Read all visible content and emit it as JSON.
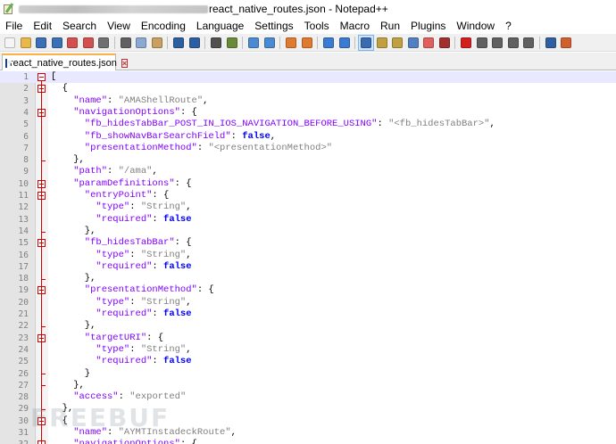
{
  "window": {
    "title": "react_native_routes.json - Notepad++"
  },
  "menu": [
    "File",
    "Edit",
    "Search",
    "View",
    "Encoding",
    "Language",
    "Settings",
    "Tools",
    "Macro",
    "Run",
    "Plugins",
    "Window",
    "?"
  ],
  "toolbar_icons": [
    {
      "name": "new-file-icon",
      "color": "#f5f5f5"
    },
    {
      "name": "open-file-icon",
      "color": "#e8b84a"
    },
    {
      "name": "save-icon",
      "color": "#3b6fb6"
    },
    {
      "name": "save-all-icon",
      "color": "#3b6fb6"
    },
    {
      "name": "close-icon",
      "color": "#d45050"
    },
    {
      "name": "close-all-icon",
      "color": "#d45050"
    },
    {
      "name": "print-icon",
      "color": "#707070"
    },
    {
      "name": "sep"
    },
    {
      "name": "cut-icon",
      "color": "#606060"
    },
    {
      "name": "copy-icon",
      "color": "#8aa8d0"
    },
    {
      "name": "paste-icon",
      "color": "#c8a060"
    },
    {
      "name": "sep"
    },
    {
      "name": "undo-icon",
      "color": "#2d5fa0"
    },
    {
      "name": "redo-icon",
      "color": "#2d5fa0"
    },
    {
      "name": "sep"
    },
    {
      "name": "find-icon",
      "color": "#505050"
    },
    {
      "name": "replace-icon",
      "color": "#6a8a3a"
    },
    {
      "name": "sep"
    },
    {
      "name": "zoom-in-icon",
      "color": "#4a8ad0"
    },
    {
      "name": "zoom-out-icon",
      "color": "#4a8ad0"
    },
    {
      "name": "sep"
    },
    {
      "name": "sync-vertical-icon",
      "color": "#e07a30"
    },
    {
      "name": "sync-horizontal-icon",
      "color": "#e07a30"
    },
    {
      "name": "sep"
    },
    {
      "name": "word-wrap-icon",
      "color": "#3a7ad0"
    },
    {
      "name": "show-all-chars-icon",
      "color": "#3a7ad0"
    },
    {
      "name": "sep"
    },
    {
      "name": "indent-guide-icon",
      "color": "#3a6ab0",
      "active": true
    },
    {
      "name": "language-icon",
      "color": "#c0a040"
    },
    {
      "name": "document-map-icon",
      "color": "#c0a040"
    },
    {
      "name": "function-list-icon",
      "color": "#5080c0"
    },
    {
      "name": "folder-workspace-icon",
      "color": "#e06060"
    },
    {
      "name": "monitoring-icon",
      "color": "#a03030"
    },
    {
      "name": "sep"
    },
    {
      "name": "record-macro-icon",
      "color": "#d02020"
    },
    {
      "name": "stop-record-icon",
      "color": "#606060"
    },
    {
      "name": "playback-macro-icon",
      "color": "#606060"
    },
    {
      "name": "run-macro-multiple-icon",
      "color": "#606060"
    },
    {
      "name": "save-macro-icon",
      "color": "#606060"
    },
    {
      "name": "sep"
    },
    {
      "name": "plugin-manager-icon",
      "color": "#3060a0"
    },
    {
      "name": "plugin-admin-icon",
      "color": "#d06030"
    }
  ],
  "tab": {
    "label": "react_native_routes.json"
  },
  "editor": {
    "lines": [
      {
        "n": "1",
        "tokens": [
          [
            "p",
            "["
          ]
        ],
        "fold": "open",
        "current": true
      },
      {
        "n": "2",
        "tokens": [
          [
            "p",
            "  {"
          ]
        ],
        "fold": "open"
      },
      {
        "n": "3",
        "tokens": [
          [
            "k",
            "    \"name\""
          ],
          [
            "p",
            ": "
          ],
          [
            "s",
            "\"AMAShellRoute\""
          ],
          [
            "p",
            ","
          ]
        ]
      },
      {
        "n": "4",
        "tokens": [
          [
            "k",
            "    \"navigationOptions\""
          ],
          [
            "p",
            ": {"
          ]
        ],
        "fold": "open"
      },
      {
        "n": "5",
        "tokens": [
          [
            "k",
            "      \"fb_hidesTabBar_POST_IN_IOS_NAVIGATION_BEFORE_USING\""
          ],
          [
            "p",
            ": "
          ],
          [
            "s",
            "\"<fb_hidesTabBar>\""
          ],
          [
            "p",
            ","
          ]
        ]
      },
      {
        "n": "6",
        "tokens": [
          [
            "k",
            "      \"fb_showNavBarSearchField\""
          ],
          [
            "p",
            ": "
          ],
          [
            "b",
            "false"
          ],
          [
            "p",
            ","
          ]
        ]
      },
      {
        "n": "7",
        "tokens": [
          [
            "k",
            "      \"presentationMethod\""
          ],
          [
            "p",
            ": "
          ],
          [
            "s",
            "\"<presentationMethod>\""
          ]
        ]
      },
      {
        "n": "8",
        "tokens": [
          [
            "p",
            "    },"
          ]
        ],
        "fold": "end"
      },
      {
        "n": "9",
        "tokens": [
          [
            "k",
            "    \"path\""
          ],
          [
            "p",
            ": "
          ],
          [
            "s",
            "\"/ama\""
          ],
          [
            "p",
            ","
          ]
        ]
      },
      {
        "n": "10",
        "tokens": [
          [
            "k",
            "    \"paramDefinitions\""
          ],
          [
            "p",
            ": {"
          ]
        ],
        "fold": "open"
      },
      {
        "n": "11",
        "tokens": [
          [
            "k",
            "      \"entryPoint\""
          ],
          [
            "p",
            ": {"
          ]
        ],
        "fold": "open"
      },
      {
        "n": "12",
        "tokens": [
          [
            "k",
            "        \"type\""
          ],
          [
            "p",
            ": "
          ],
          [
            "s",
            "\"String\""
          ],
          [
            "p",
            ","
          ]
        ]
      },
      {
        "n": "13",
        "tokens": [
          [
            "k",
            "        \"required\""
          ],
          [
            "p",
            ": "
          ],
          [
            "b",
            "false"
          ]
        ]
      },
      {
        "n": "14",
        "tokens": [
          [
            "p",
            "      },"
          ]
        ],
        "fold": "end"
      },
      {
        "n": "15",
        "tokens": [
          [
            "k",
            "      \"fb_hidesTabBar\""
          ],
          [
            "p",
            ": {"
          ]
        ],
        "fold": "open"
      },
      {
        "n": "16",
        "tokens": [
          [
            "k",
            "        \"type\""
          ],
          [
            "p",
            ": "
          ],
          [
            "s",
            "\"String\""
          ],
          [
            "p",
            ","
          ]
        ]
      },
      {
        "n": "17",
        "tokens": [
          [
            "k",
            "        \"required\""
          ],
          [
            "p",
            ": "
          ],
          [
            "b",
            "false"
          ]
        ]
      },
      {
        "n": "18",
        "tokens": [
          [
            "p",
            "      },"
          ]
        ],
        "fold": "end"
      },
      {
        "n": "19",
        "tokens": [
          [
            "k",
            "      \"presentationMethod\""
          ],
          [
            "p",
            ": {"
          ]
        ],
        "fold": "open"
      },
      {
        "n": "20",
        "tokens": [
          [
            "k",
            "        \"type\""
          ],
          [
            "p",
            ": "
          ],
          [
            "s",
            "\"String\""
          ],
          [
            "p",
            ","
          ]
        ]
      },
      {
        "n": "21",
        "tokens": [
          [
            "k",
            "        \"required\""
          ],
          [
            "p",
            ": "
          ],
          [
            "b",
            "false"
          ]
        ]
      },
      {
        "n": "22",
        "tokens": [
          [
            "p",
            "      },"
          ]
        ],
        "fold": "end"
      },
      {
        "n": "23",
        "tokens": [
          [
            "k",
            "      \"targetURI\""
          ],
          [
            "p",
            ": {"
          ]
        ],
        "fold": "open"
      },
      {
        "n": "24",
        "tokens": [
          [
            "k",
            "        \"type\""
          ],
          [
            "p",
            ": "
          ],
          [
            "s",
            "\"String\""
          ],
          [
            "p",
            ","
          ]
        ]
      },
      {
        "n": "25",
        "tokens": [
          [
            "k",
            "        \"required\""
          ],
          [
            "p",
            ": "
          ],
          [
            "b",
            "false"
          ]
        ]
      },
      {
        "n": "26",
        "tokens": [
          [
            "p",
            "      }"
          ]
        ],
        "fold": "end"
      },
      {
        "n": "27",
        "tokens": [
          [
            "p",
            "    },"
          ]
        ],
        "fold": "end"
      },
      {
        "n": "28",
        "tokens": [
          [
            "k",
            "    \"access\""
          ],
          [
            "p",
            ": "
          ],
          [
            "s",
            "\"exported\""
          ]
        ]
      },
      {
        "n": "29",
        "tokens": [
          [
            "p",
            "  },"
          ]
        ],
        "fold": "end"
      },
      {
        "n": "30",
        "tokens": [
          [
            "p",
            "  {"
          ]
        ],
        "fold": "open"
      },
      {
        "n": "31",
        "tokens": [
          [
            "k",
            "    \"name\""
          ],
          [
            "p",
            ": "
          ],
          [
            "s",
            "\"AYMTInstadeckRoute\""
          ],
          [
            "p",
            ","
          ]
        ]
      },
      {
        "n": "32",
        "tokens": [
          [
            "k",
            "    \"navigationOptions\""
          ],
          [
            "p",
            ": {"
          ]
        ],
        "fold": "open"
      }
    ]
  }
}
